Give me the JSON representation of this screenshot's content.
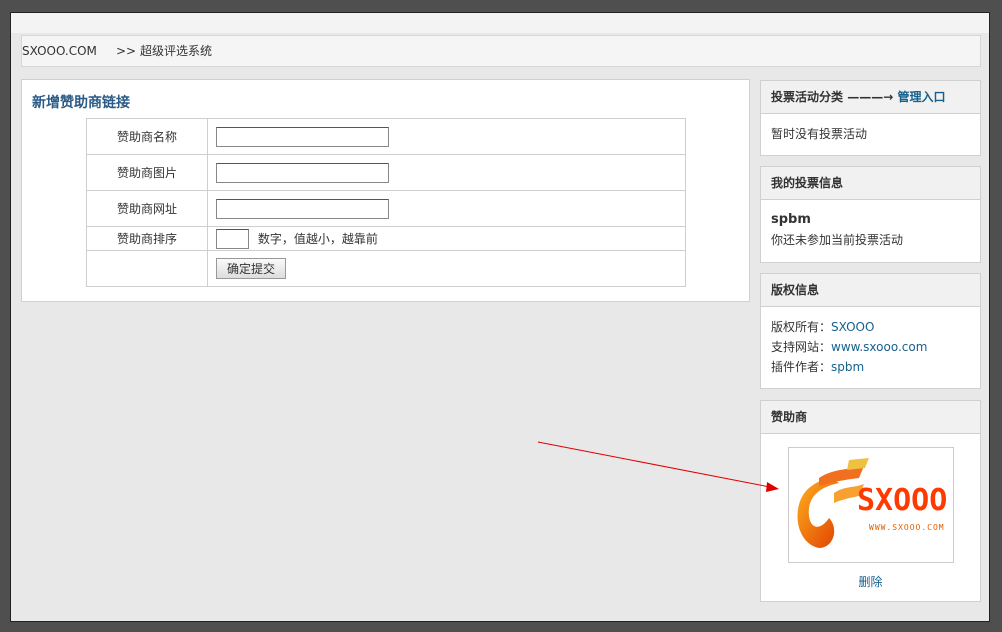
{
  "breadcrumb": {
    "site": "SXOOO.COM",
    "separator": ">>",
    "section": "超级评选系统"
  },
  "form": {
    "title": "新增赞助商链接",
    "fields": [
      {
        "label": "赞助商名称",
        "value": ""
      },
      {
        "label": "赞助商图片",
        "value": ""
      },
      {
        "label": "赞助商网址",
        "value": ""
      }
    ],
    "order": {
      "label": "赞助商排序",
      "value": "",
      "hint": "数字，值越小，越靠前"
    },
    "submit": "确定提交"
  },
  "sidebar": {
    "vote_category": {
      "title": "投票活动分类",
      "arrow": "———→",
      "admin_link": "管理入口",
      "empty": "暂时没有投票活动"
    },
    "my_vote": {
      "title": "我的投票信息",
      "user": "spbm",
      "status": "你还未参加当前投票活动"
    },
    "copyright": {
      "title": "版权信息",
      "rows": [
        {
          "label": "版权所有：",
          "value": "SXOOO"
        },
        {
          "label": "支持网站：",
          "value": "www.sxooo.com"
        },
        {
          "label": "插件作者：",
          "value": "spbm"
        }
      ]
    },
    "sponsor": {
      "title": "赞助商",
      "logo_text": "SXOOO",
      "logo_url": "www.sxooo.com",
      "delete": "删除"
    }
  },
  "colors": {
    "accent": "#17618e",
    "title": "#2b5b86",
    "annotation_arrow": "#e00000"
  }
}
